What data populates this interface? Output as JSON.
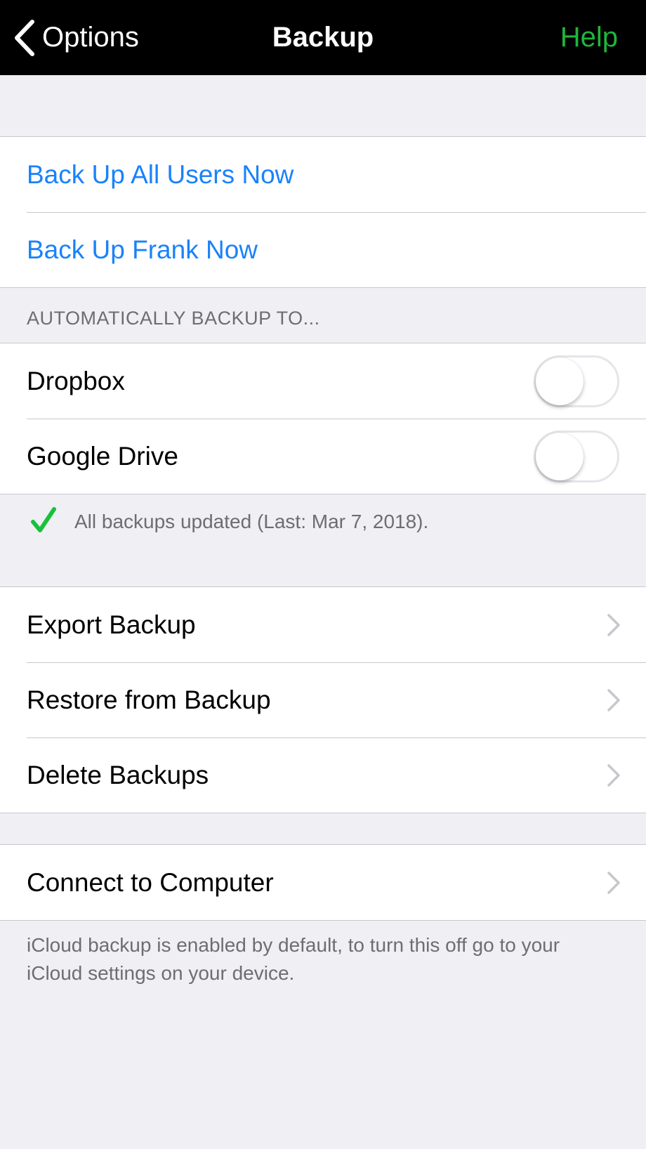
{
  "colors": {
    "nav_bg": "#000000",
    "help_green": "#1fb53a",
    "action_blue": "#1a82fb",
    "check_green": "#18c13b",
    "background": "#efeff4"
  },
  "navbar": {
    "back_label": "Options",
    "back_icon": "chevron-left-icon",
    "title": "Backup",
    "help_label": "Help"
  },
  "actions": {
    "backup_all": "Back Up All Users Now",
    "backup_user": "Back Up Frank Now"
  },
  "auto_backup": {
    "header": "AUTOMATICALLY BACKUP TO...",
    "dropbox": {
      "label": "Dropbox",
      "enabled": false
    },
    "google_drive": {
      "label": "Google Drive",
      "enabled": false
    }
  },
  "status": {
    "icon": "checkmark-icon",
    "text": "All backups updated (Last: Mar 7, 2018)."
  },
  "manage": {
    "export": "Export Backup",
    "restore": "Restore from Backup",
    "delete": "Delete Backups"
  },
  "computer": {
    "connect": "Connect to Computer"
  },
  "footer": {
    "note": "iCloud backup is enabled by default, to turn this off go to your iCloud settings on your device."
  }
}
